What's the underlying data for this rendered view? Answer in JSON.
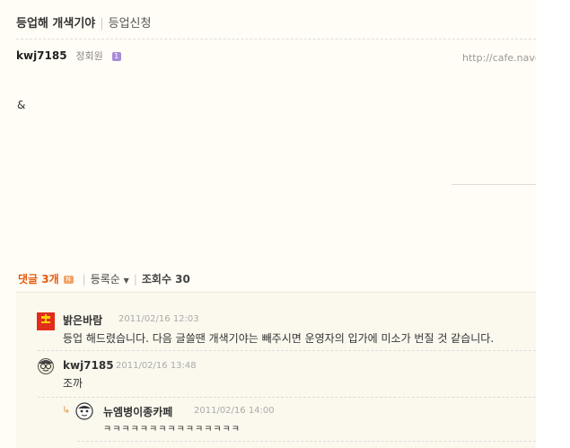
{
  "post": {
    "title": "등업해 개색기야",
    "category": "등업신청",
    "author": "kwj7185",
    "grade": "정회원",
    "grade_badge": "1",
    "url": "http://cafe.nave",
    "body": "&"
  },
  "comment_summary": {
    "label": "댓글 3개",
    "new_badge": "N",
    "sort": "등록순",
    "views": "조회수 30"
  },
  "comments": [
    {
      "author": "밝은바람",
      "date": "2011/02/16 12:03",
      "text": "등업 해드렸습니다. 다음 글쓸땐 개색기야는 빼주시면 운영자의 입가에 미소가 번질 것 같습니다.",
      "avatar_icon": "red-character-avatar-icon"
    },
    {
      "author": "kwj7185",
      "date": "2011/02/16 13:48",
      "text": "조까",
      "avatar_icon": "glasses-face-avatar-icon"
    },
    {
      "author": "뉴엠병이종카페",
      "date": "2011/02/16 14:00",
      "text": "ㅋㅋㅋㅋㅋㅋㅋㅋㅋㅋㅋㅋㅋㅋㅋ",
      "avatar_icon": "cartoon-face-avatar-icon",
      "reply": true
    }
  ],
  "colors": {
    "accent": "#e45a0f",
    "background": "#fffdf5",
    "comment_bg": "#fbf8ee"
  }
}
